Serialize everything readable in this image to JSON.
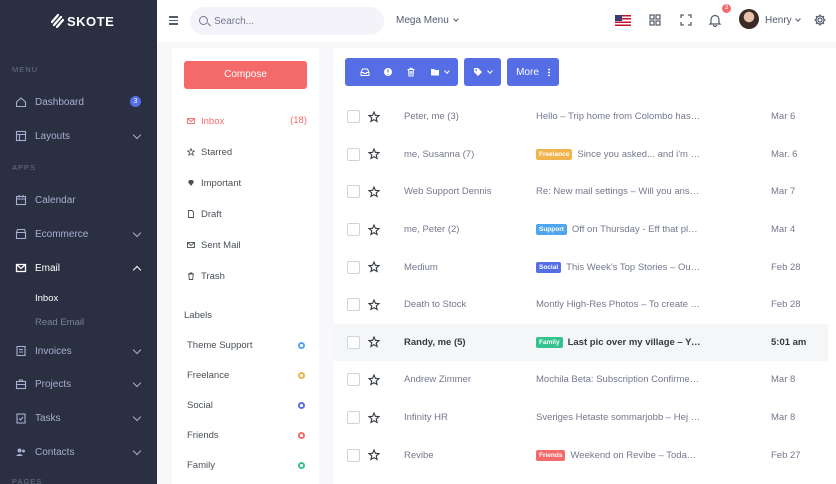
{
  "brand": {
    "name": "SKOTE"
  },
  "sidebar": {
    "menu_title": "MENU",
    "apps_title": "APPS",
    "pages_title": "PAGES",
    "dashboard": {
      "label": "Dashboard",
      "badge": "3"
    },
    "layouts": "Layouts",
    "calendar": "Calendar",
    "ecommerce": "Ecommerce",
    "email": "Email",
    "email_sub": [
      "Inbox",
      "Read Email"
    ],
    "invoices": "Invoices",
    "projects": "Projects",
    "tasks": "Tasks",
    "contacts": "Contacts"
  },
  "topbar": {
    "search_placeholder": "Search...",
    "mega_menu": "Mega Menu",
    "notification_count": "3",
    "user_name": "Henry"
  },
  "email_nav": {
    "compose": "Compose",
    "folders": [
      {
        "label": "Inbox",
        "count": "(18)",
        "icon": "mail-icon"
      },
      {
        "label": "Starred",
        "icon": "star-icon"
      },
      {
        "label": "Important",
        "icon": "diamond-icon"
      },
      {
        "label": "Draft",
        "icon": "file-icon"
      },
      {
        "label": "Sent Mail",
        "icon": "send-icon"
      },
      {
        "label": "Trash",
        "icon": "trash-icon"
      }
    ],
    "labels_title": "Labels",
    "labels": [
      {
        "name": "Theme Support",
        "color": "#50a5f1"
      },
      {
        "name": "Freelance",
        "color": "#f1b44c"
      },
      {
        "name": "Social",
        "color": "#556ee6"
      },
      {
        "name": "Friends",
        "color": "#f46a6a"
      },
      {
        "name": "Family",
        "color": "#34c38f"
      }
    ]
  },
  "toolbar": {
    "more": "More"
  },
  "emails": [
    {
      "sender": "Peter, me (3)",
      "tag": "",
      "subject": "Hello – Trip home from Colombo has been arranged",
      "date": "Mar 6",
      "unread": false
    },
    {
      "sender": "me, Susanna (7)",
      "tag": "Freelance",
      "tag_color": "#f1b44c",
      "subject": "Since you asked... and i'm inconceivably bored",
      "date": "Mar. 6",
      "unread": false
    },
    {
      "sender": "Web Support Dennis",
      "tag": "",
      "subject": "Re: New mail settings – Will you answer him asap?",
      "date": "Mar 7",
      "unread": false
    },
    {
      "sender": "me, Peter (2)",
      "tag": "Support",
      "tag_color": "#50a5f1",
      "subject": "Off on Thursday - Eff that place, you might",
      "date": "Mar 4",
      "unread": false
    },
    {
      "sender": "Medium",
      "tag": "Social",
      "tag_color": "#556ee6",
      "subject": "This Week's Top Stories – Our top pick for you",
      "date": "Feb 28",
      "unread": false
    },
    {
      "sender": "Death to Stock",
      "tag": "",
      "subject": "Montly High-Res Photos – To create this month's",
      "date": "Feb 28",
      "unread": false
    },
    {
      "sender": "Randy, me (5)",
      "tag": "Family",
      "tag_color": "#34c38f",
      "subject": "Last pic over my village – Yeah i'd like that",
      "date": "5:01 am",
      "unread": true
    },
    {
      "sender": "Andrew Zimmer",
      "tag": "",
      "subject": "Mochila Beta: Subscription Confirmed – You've",
      "date": "Mar 8",
      "unread": false
    },
    {
      "sender": "Infinity HR",
      "tag": "",
      "subject": "Sveriges Hetaste sommarjobb – Hej Nicklas",
      "date": "Mar 8",
      "unread": false
    },
    {
      "sender": "Revibe",
      "tag": "Friends",
      "tag_color": "#f46a6a",
      "subject": "Weekend on Revibe – Today's Friday",
      "date": "Feb 27",
      "unread": false
    }
  ]
}
